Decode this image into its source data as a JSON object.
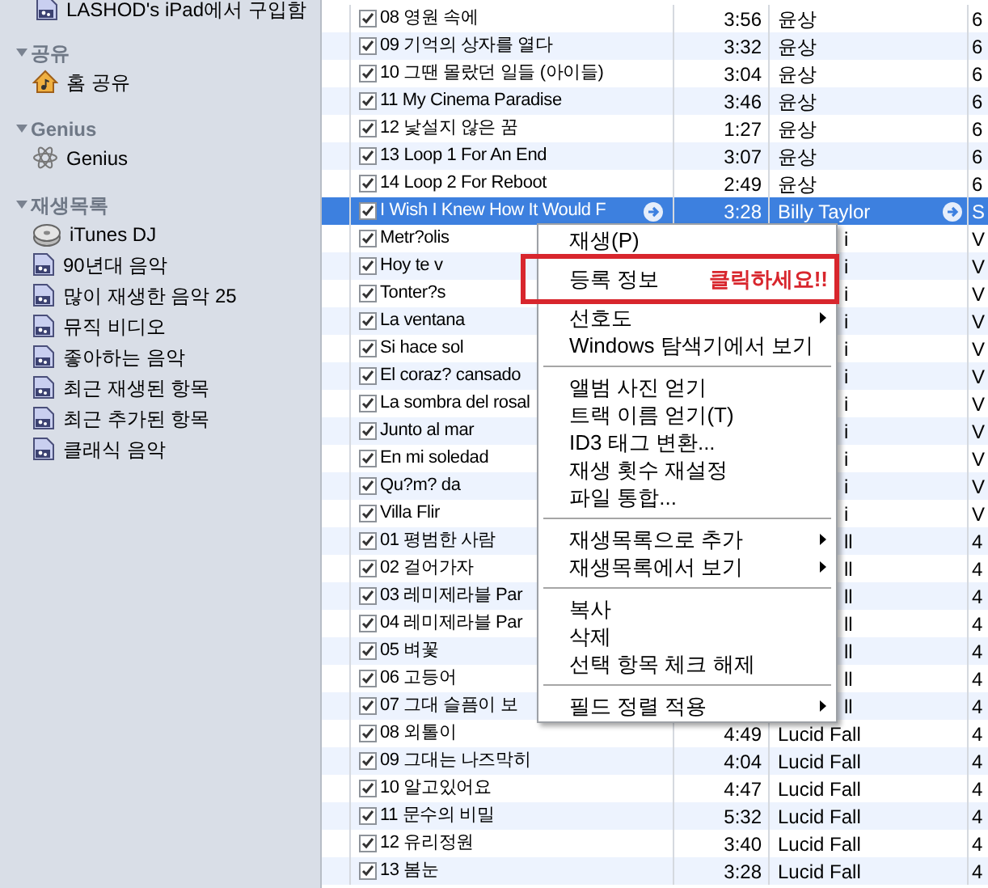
{
  "sidebar": {
    "top_item": {
      "label": "LASHOD's iPad에서 구입함"
    },
    "sections": [
      {
        "title": "공유",
        "expanded": true,
        "items": [
          {
            "label": "홈 공유",
            "kind": "home"
          }
        ]
      },
      {
        "title": "Genius",
        "expanded": true,
        "items": [
          {
            "label": "Genius",
            "kind": "genius"
          }
        ]
      },
      {
        "title": "재생목록",
        "expanded": true,
        "items": [
          {
            "label": "iTunes DJ",
            "kind": "dj"
          },
          {
            "label": "90년대 음악",
            "kind": "playlist"
          },
          {
            "label": "많이 재생한 음악 25",
            "kind": "playlist"
          },
          {
            "label": "뮤직 비디오",
            "kind": "playlist"
          },
          {
            "label": "좋아하는 음악",
            "kind": "playlist"
          },
          {
            "label": "최근 재생된 항목",
            "kind": "playlist"
          },
          {
            "label": "최근 추가된 항목",
            "kind": "playlist"
          },
          {
            "label": "클래식 음악",
            "kind": "playlist"
          }
        ]
      }
    ]
  },
  "tracks": [
    {
      "checked": true,
      "name": "08 영원 속에",
      "time": "3:56",
      "artist": "윤상",
      "column_4": "6",
      "selected": false,
      "covered": false
    },
    {
      "checked": true,
      "name": "09 기억의 상자를 열다",
      "time": "3:32",
      "artist": "윤상",
      "column_4": "6",
      "selected": false,
      "covered": false
    },
    {
      "checked": true,
      "name": "10 그땐 몰랐던 일들 (아이들)",
      "time": "3:04",
      "artist": "윤상",
      "column_4": "6",
      "selected": false,
      "covered": false
    },
    {
      "checked": true,
      "name": "11 My Cinema Paradise",
      "time": "3:46",
      "artist": "윤상",
      "column_4": "6",
      "selected": false,
      "covered": false
    },
    {
      "checked": true,
      "name": "12 낯설지 않은 꿈",
      "time": "1:27",
      "artist": "윤상",
      "column_4": "6",
      "selected": false,
      "covered": false
    },
    {
      "checked": true,
      "name": "13 Loop 1 For An End",
      "time": "3:07",
      "artist": "윤상",
      "column_4": "6",
      "selected": false,
      "covered": false
    },
    {
      "checked": true,
      "name": "14 Loop 2 For Reboot",
      "time": "2:49",
      "artist": "윤상",
      "column_4": "6",
      "selected": false,
      "covered": false
    },
    {
      "checked": true,
      "name": "I Wish I Knew How It Would F",
      "time": "3:28",
      "artist": "Billy Taylor",
      "column_4": "S",
      "selected": true,
      "covered": false
    },
    {
      "checked": true,
      "name": "Metr?olis",
      "artist": "i",
      "column_4": "V",
      "selected": false,
      "covered": true
    },
    {
      "checked": true,
      "name": "Hoy te v",
      "artist": "i",
      "column_4": "V",
      "selected": false,
      "covered": true
    },
    {
      "checked": true,
      "name": "Tonter?s",
      "artist": "i",
      "column_4": "V",
      "selected": false,
      "covered": true
    },
    {
      "checked": true,
      "name": "La ventana",
      "artist": "i",
      "column_4": "V",
      "selected": false,
      "covered": true
    },
    {
      "checked": true,
      "name": "Si hace sol",
      "artist": "i",
      "column_4": "V",
      "selected": false,
      "covered": true
    },
    {
      "checked": true,
      "name": "El coraz? cansado",
      "artist": "i",
      "column_4": "V",
      "selected": false,
      "covered": true
    },
    {
      "checked": true,
      "name": "La sombra del rosal",
      "artist": "i",
      "column_4": "V",
      "selected": false,
      "covered": true
    },
    {
      "checked": true,
      "name": "Junto al mar",
      "artist": "i",
      "column_4": "V",
      "selected": false,
      "covered": true
    },
    {
      "checked": true,
      "name": "En mi soledad",
      "artist": "i",
      "column_4": "V",
      "selected": false,
      "covered": true
    },
    {
      "checked": true,
      "name": "Qu?m? da",
      "artist": "i",
      "column_4": "V",
      "selected": false,
      "covered": true
    },
    {
      "checked": true,
      "name": "Villa Flir",
      "artist": "i",
      "column_4": "V",
      "selected": false,
      "covered": true
    },
    {
      "checked": true,
      "name": "01 평범한 사람",
      "artist": "ll",
      "column_4": "4",
      "selected": false,
      "covered": true
    },
    {
      "checked": true,
      "name": "02 걸어가자",
      "artist": "ll",
      "column_4": "4",
      "selected": false,
      "covered": true
    },
    {
      "checked": true,
      "name": "03 레미제라블 Par",
      "artist": "ll",
      "column_4": "4",
      "selected": false,
      "covered": true
    },
    {
      "checked": true,
      "name": "04 레미제라블 Par",
      "artist": "ll",
      "column_4": "4",
      "selected": false,
      "covered": true
    },
    {
      "checked": true,
      "name": "05 벼꽃",
      "artist": "ll",
      "column_4": "4",
      "selected": false,
      "covered": true
    },
    {
      "checked": true,
      "name": "06 고등어",
      "artist": "ll",
      "column_4": "4",
      "selected": false,
      "covered": true
    },
    {
      "checked": true,
      "name": "07 그대 슬픔이 보",
      "artist": "ll",
      "column_4": "4",
      "selected": false,
      "covered": true
    },
    {
      "checked": true,
      "name": "08 외톨이",
      "time": "4:49",
      "artist": "Lucid Fall",
      "column_4": "4",
      "selected": false,
      "covered": false
    },
    {
      "checked": true,
      "name": "09 그대는 나즈막히",
      "time": "4:04",
      "artist": "Lucid Fall",
      "column_4": "4",
      "selected": false,
      "covered": false
    },
    {
      "checked": true,
      "name": "10 알고있어요",
      "time": "4:47",
      "artist": "Lucid Fall",
      "column_4": "4",
      "selected": false,
      "covered": false
    },
    {
      "checked": true,
      "name": "11 문수의 비밀",
      "time": "5:32",
      "artist": "Lucid Fall",
      "column_4": "4",
      "selected": false,
      "covered": false
    },
    {
      "checked": true,
      "name": "12 유리정원",
      "time": "3:40",
      "artist": "Lucid Fall",
      "column_4": "4",
      "selected": false,
      "covered": false
    },
    {
      "checked": true,
      "name": "13 봄눈",
      "time": "3:28",
      "artist": "Lucid Fall",
      "column_4": "4",
      "selected": false,
      "covered": false
    }
  ],
  "context_menu": {
    "items": [
      {
        "kind": "item",
        "label": "재생(P)",
        "submenu": false
      },
      {
        "kind": "item",
        "label": "등록 정보",
        "submenu": false,
        "annotated": true
      },
      {
        "kind": "item",
        "label": "선호도",
        "submenu": true
      },
      {
        "kind": "item",
        "label": "Windows 탐색기에서 보기",
        "submenu": false
      },
      {
        "kind": "separator"
      },
      {
        "kind": "item",
        "label": "앨범 사진 얻기",
        "submenu": false
      },
      {
        "kind": "item",
        "label": "트랙 이름 얻기(T)",
        "submenu": false
      },
      {
        "kind": "item",
        "label": "ID3 태그 변환...",
        "submenu": false
      },
      {
        "kind": "item",
        "label": "재생 횟수 재설정",
        "submenu": false
      },
      {
        "kind": "item",
        "label": "파일 통합...",
        "submenu": false
      },
      {
        "kind": "separator"
      },
      {
        "kind": "item",
        "label": "재생목록으로 추가",
        "submenu": true
      },
      {
        "kind": "item",
        "label": "재생목록에서 보기",
        "submenu": true
      },
      {
        "kind": "separator"
      },
      {
        "kind": "item",
        "label": "복사",
        "submenu": false
      },
      {
        "kind": "item",
        "label": "삭제",
        "submenu": false
      },
      {
        "kind": "item",
        "label": "선택 항목 체크 해제",
        "submenu": false
      },
      {
        "kind": "separator"
      },
      {
        "kind": "item",
        "label": "필드 정렬 적용",
        "submenu": true
      }
    ]
  },
  "annotation": {
    "text": "클릭하세요!!"
  }
}
